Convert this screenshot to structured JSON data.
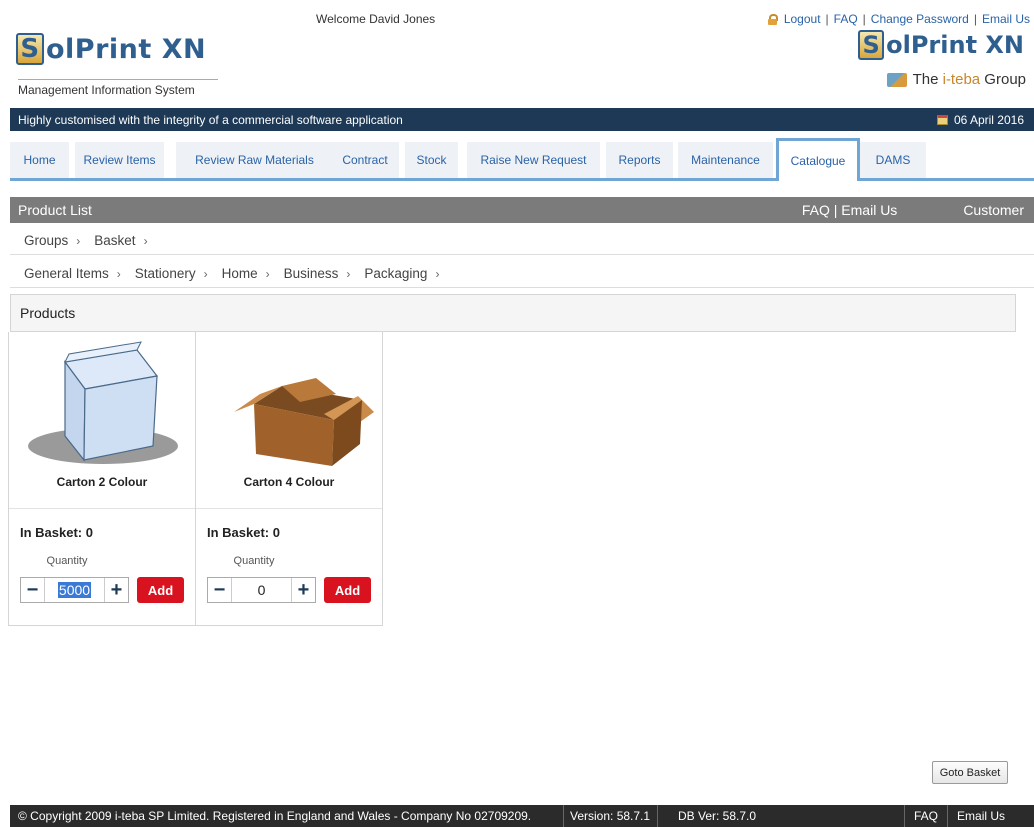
{
  "header": {
    "welcome": "Welcome  David Jones",
    "logo_initial": "S",
    "logo_rest": "olPrint XN",
    "subtitle": "Management Information System",
    "links": {
      "logout": "Logout",
      "faq": "FAQ",
      "change_password": "Change Password",
      "email_us": "Email Us",
      "separator": "|"
    },
    "group_prefix": "The ",
    "group_brand": "i-teba",
    "group_suffix": " Group"
  },
  "tagline": {
    "text": "Highly customised with the integrity of a commercial software application",
    "date": "06 April 2016"
  },
  "nav": {
    "tabs": [
      {
        "label": "Home"
      },
      {
        "label": "Review Items"
      },
      {
        "label": "Review Raw Materials"
      },
      {
        "label": "Contract"
      },
      {
        "label": "Stock"
      },
      {
        "label": "Raise New Request"
      },
      {
        "label": "Reports"
      },
      {
        "label": "Maintenance"
      },
      {
        "label": "Catalogue",
        "active": true
      },
      {
        "label": "DAMS"
      }
    ]
  },
  "product_list_bar": {
    "title": "Product List",
    "faq_email": "FAQ | Email Us",
    "customer": "Customer"
  },
  "breadcrumb_groups": {
    "items": [
      "Groups",
      "Basket"
    ],
    "separator": "›"
  },
  "breadcrumb_categories": {
    "items": [
      "General Items",
      "Stationery",
      "Home",
      "Business",
      "Packaging"
    ],
    "separator": "›"
  },
  "products_panel": {
    "title": "Products"
  },
  "products": [
    {
      "name": "Carton 2 Colour",
      "in_basket": "In Basket: 0",
      "quantity_label": "Quantity",
      "quantity": "5000",
      "minus": "−",
      "plus": "+",
      "add_label": "Add"
    },
    {
      "name": "Carton 4 Colour",
      "in_basket": "In Basket: 0",
      "quantity_label": "Quantity",
      "quantity": "0",
      "minus": "−",
      "plus": "+",
      "add_label": "Add"
    }
  ],
  "goto_basket": "Goto Basket",
  "footer": {
    "copyright": "© Copyright 2009 i-teba SP Limited. Registered in England and Wales - Company No 02709209.",
    "version": "Version: 58.7.1",
    "db_version": "DB Ver: 58.7.0",
    "faq": "FAQ",
    "email_us": "Email Us"
  },
  "colors": {
    "accent": "#6fa6d6",
    "navy": "#1d3956",
    "add_red": "#d9121f",
    "link_blue": "#2a62a8",
    "gold": "#c9862b"
  }
}
